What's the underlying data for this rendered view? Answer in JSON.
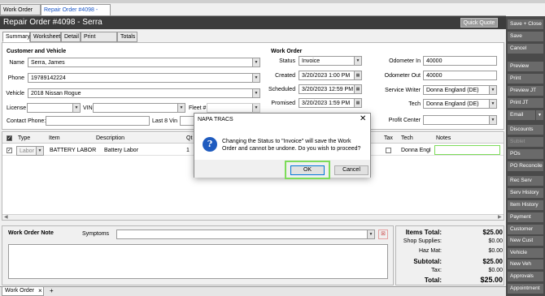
{
  "doc_tabs": [
    "Work Order List",
    "Repair Order #4098 - Serra"
  ],
  "title": "Repair Order #4098 - Serra",
  "quick_quote": "Quick Quote",
  "sub_tabs": [
    "Summary",
    "Worksheet",
    "Detail",
    "Print Options",
    "Totals"
  ],
  "customer": {
    "section_title": "Customer and Vehicle",
    "name_label": "Name",
    "name": "Serra, James",
    "phone_label": "Phone",
    "phone": "19789142224",
    "vehicle_label": "Vehicle",
    "vehicle": "2018 Nissan Rogue",
    "license_label": "License",
    "vin_label": "VIN",
    "fleet_label": "Fleet #",
    "contact_phone_label": "Contact Phone:",
    "last8_label": "Last 8 Vin"
  },
  "work_order": {
    "section_title": "Work Order",
    "status_label": "Status",
    "status": "Invoice",
    "created_label": "Created",
    "created": "3/20/2023 1:00 PM",
    "scheduled_label": "Scheduled",
    "scheduled": "3/20/2023 12:59 PM",
    "promised_label": "Promised",
    "promised": "3/20/2023 1:59 PM",
    "odometer_in_label": "Odometer In",
    "odometer_in": "40000",
    "odometer_out_label": "Odometer Out",
    "odometer_out": "40000",
    "service_writer_label": "Service Writer",
    "service_writer": "Donna England (DE)",
    "tech_label": "Tech",
    "tech": "Donna England (DE)",
    "profit_center_label": "Profit Center"
  },
  "grid": {
    "columns": [
      "Type",
      "Item",
      "Description",
      "Qt",
      "Tax",
      "Tech",
      "Notes"
    ],
    "rows": [
      {
        "type": "Labor",
        "item": "BATTERY LABOR",
        "description": "Battery Labor",
        "qty": "1",
        "tech": "Donna Engl",
        "notes": ""
      }
    ]
  },
  "notes": {
    "title": "Work Order Note",
    "symptoms_label": "Symptoms"
  },
  "totals": {
    "items_total_label": "Items Total:",
    "items_total": "$25.00",
    "shop_supplies_label": "Shop Supplies:",
    "shop_supplies": "$0.00",
    "haz_mat_label": "Haz Mat:",
    "haz_mat": "$0.00",
    "subtotal_label": "Subtotal:",
    "subtotal": "$25.00",
    "tax_label": "Tax:",
    "tax": "$0.00",
    "total_label": "Total:",
    "total": "$25.00"
  },
  "sidebar": [
    "Save + Close",
    "Save",
    "Cancel",
    "Preview",
    "Print",
    "Preview JT",
    "Print JT",
    "Email",
    "Discounts",
    "Sublet",
    "POs",
    "PO Reconcile",
    "Rec Serv",
    "Serv History",
    "Item History",
    "Payment",
    "Customer",
    "New Cust",
    "Vehicle",
    "New Veh",
    "Approvals",
    "Appointment"
  ],
  "bottom_tab": {
    "label": "Work Order",
    "close": "×",
    "add": "+"
  },
  "dialog": {
    "title": "NAPA TRACS",
    "message": "Changing the Status to \"Invoice\" will save the Work Order and cannot be undone. Do you wish to proceed?",
    "ok": "OK",
    "cancel": "Cancel"
  },
  "colors": {
    "titlebar": "#3c3c3c",
    "sidebar": "#4a4a4a",
    "link_blue": "#1a56c7",
    "highlight": "#7ddc5a",
    "info_icon": "#1f5bbf"
  }
}
